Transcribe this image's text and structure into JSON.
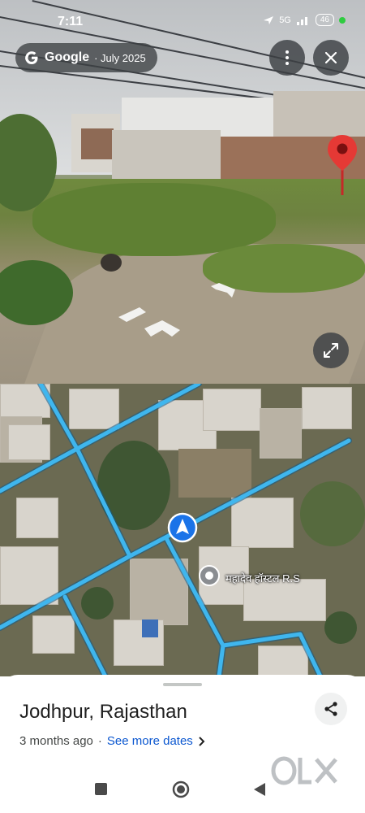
{
  "status_bar": {
    "time": "7:11",
    "network": "5G",
    "battery": "46"
  },
  "street_view": {
    "brand": "Google",
    "capture_date": "· July 2025",
    "icons": [
      "more-vert-icon",
      "close-icon",
      "expand-icon",
      "location-pin-icon",
      "navigation-chevron-icon"
    ]
  },
  "map": {
    "place_label": "महादेव हॉस्टल R.S",
    "route_color": "#3fb6ee",
    "icons": [
      "navigation-arrow-icon",
      "place-marker-icon"
    ]
  },
  "info_sheet": {
    "title": "Jodhpur, Rajasthan",
    "age": "3 months ago",
    "separator": "·",
    "see_more": "See more dates",
    "icons": [
      "share-icon",
      "chevron-right-icon"
    ]
  },
  "watermark": "OLX",
  "colors": {
    "accent_blue": "#0b57d0",
    "pin_red": "#e53935",
    "map_route": "#3fb6ee"
  }
}
